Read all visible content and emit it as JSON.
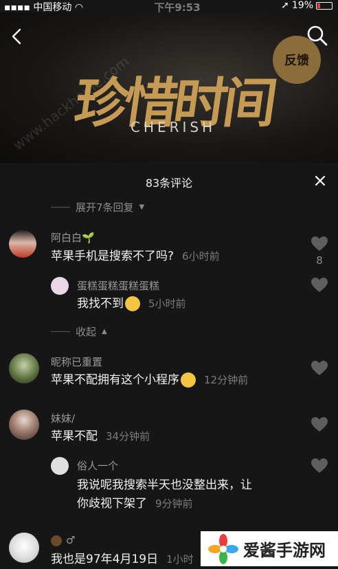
{
  "status_bar": {
    "carrier": "中国移动",
    "time": "下午9:53",
    "battery": "19%"
  },
  "header": {
    "title_art": "珍惜时间",
    "subtitle_art": "CHERISH",
    "feedback_label": "反馈",
    "watermark": "www.hackhome.com"
  },
  "panel": {
    "title": "83条评论",
    "expand_label": "展开7条回复",
    "collapse_label": "收起"
  },
  "comments": [
    {
      "name": "阿白白🌱",
      "text": "苹果手机是搜索不了吗?",
      "time": "6小时前",
      "likes": "8"
    },
    {
      "name": "蛋糕蛋糕蛋糕蛋糕",
      "text": "我找不到",
      "time": "5小时前"
    },
    {
      "name": "昵称已重置",
      "text": "苹果不配拥有这个小程序",
      "time": "12分钟前"
    },
    {
      "name": "妹妹/",
      "text": "苹果不配",
      "time": "34分钟前"
    },
    {
      "name": "俗人一个",
      "text_line1": "我说呢我搜索半天也没整出来，让",
      "text_line2": "你歧视下架了",
      "time": "9分钟前"
    },
    {
      "name": "♂",
      "text": "我也是97年4月19日",
      "time": "1小时"
    }
  ],
  "logo": {
    "text": "爱酱手游网"
  },
  "colors": {
    "accent": "#c49a55",
    "feedback": "#8b6d3c",
    "battery_low": "#ff3b30"
  }
}
